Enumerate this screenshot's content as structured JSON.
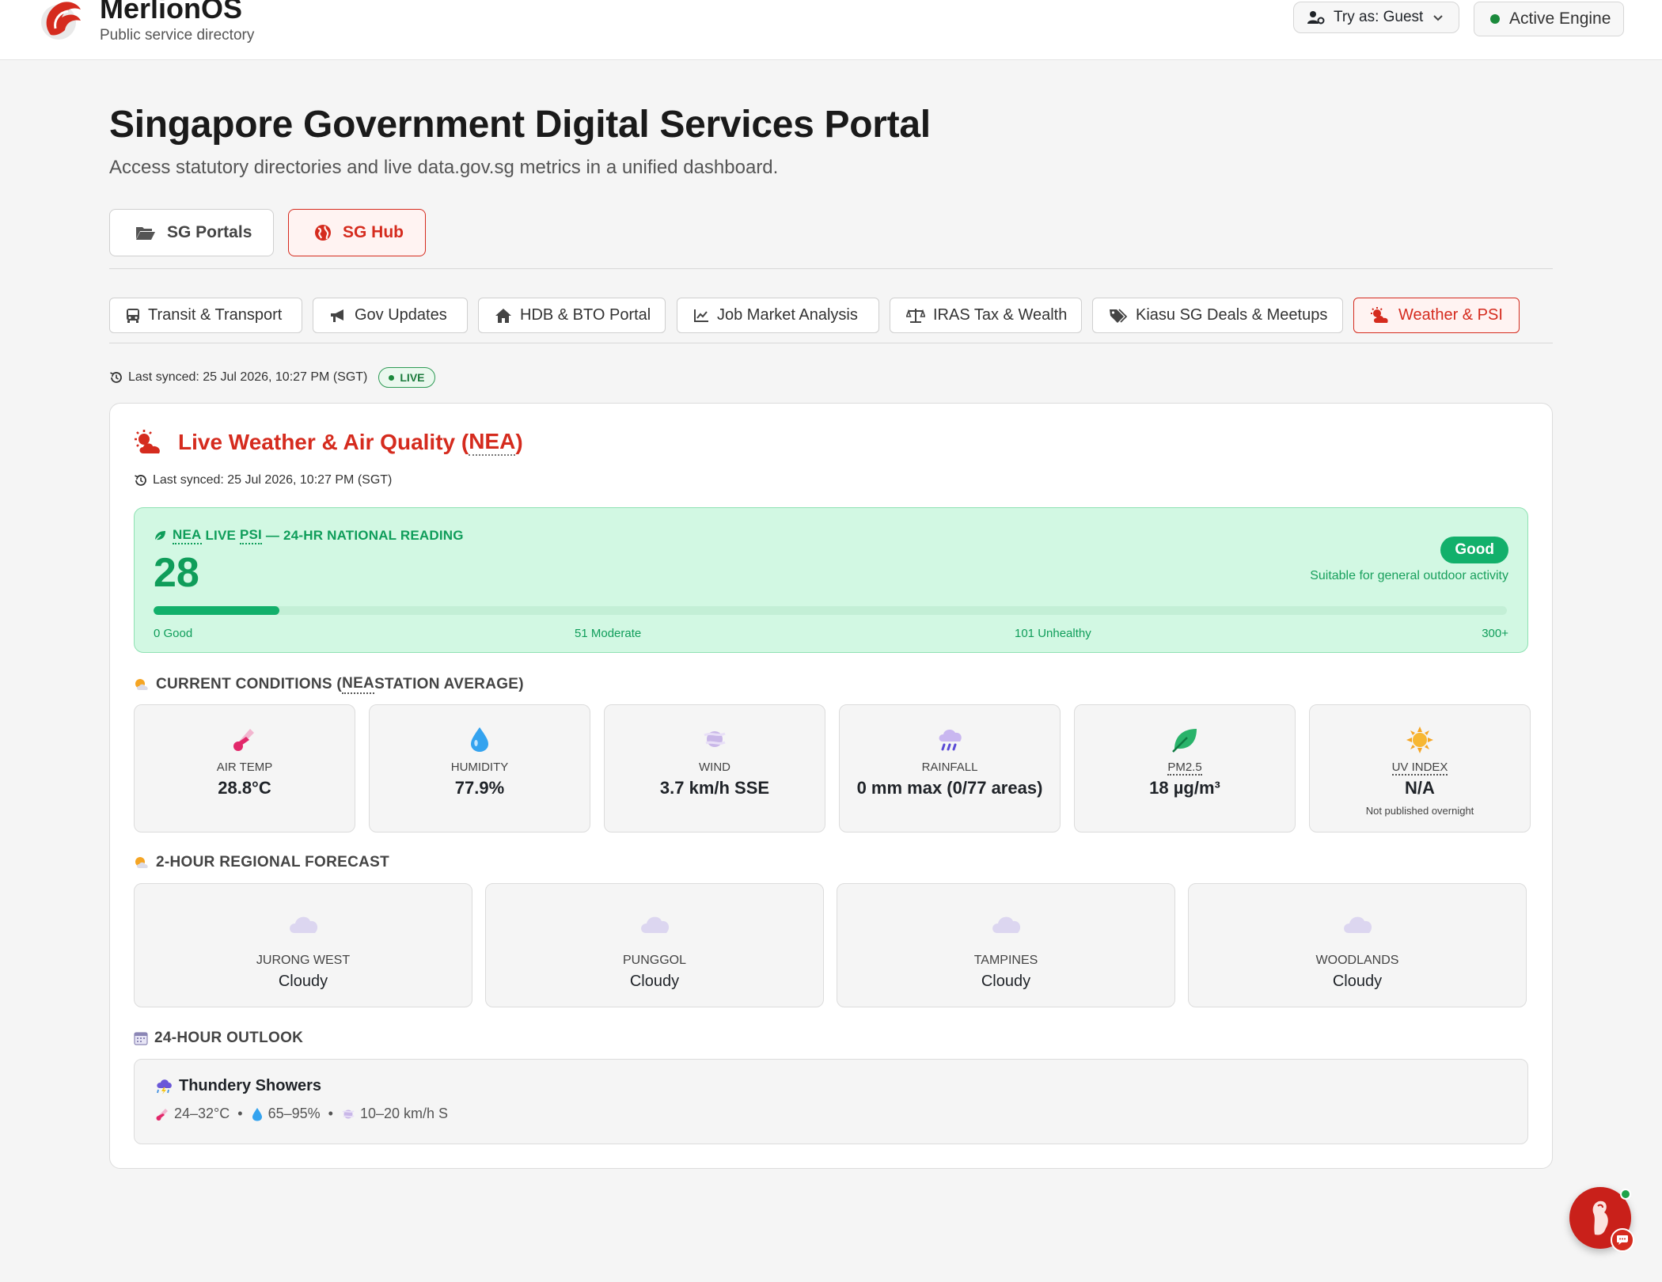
{
  "brand": {
    "name": "MerlionOS",
    "subtitle": "Public service directory"
  },
  "header": {
    "try_as_label": "Try as: Guest",
    "engine_label": "Active Engine"
  },
  "hero": {
    "title": "Singapore Government Digital Services Portal",
    "subtitle": "Access statutory directories and live data.gov.sg metrics in a unified dashboard."
  },
  "main_tabs": [
    {
      "label": "SG Portals",
      "icon": "folder-open-icon",
      "active": false
    },
    {
      "label": "SG Hub",
      "icon": "globe-icon",
      "active": true
    }
  ],
  "sub_tabs": [
    {
      "label": "Transit & Transport",
      "icon": "bus-icon",
      "active": false
    },
    {
      "label": "Gov Updates",
      "icon": "megaphone-icon",
      "active": false
    },
    {
      "label": "HDB & BTO Portal",
      "icon": "house-icon",
      "active": false
    },
    {
      "label": "Job Market Analysis",
      "icon": "chart-line-icon",
      "active": false
    },
    {
      "label": "IRAS Tax & Wealth",
      "icon": "scale-icon",
      "active": false
    },
    {
      "label": "Kiasu SG Deals & Meetups",
      "icon": "tags-icon",
      "active": false
    },
    {
      "label": "Weather & PSI",
      "icon": "cloud-sun-icon",
      "active": true
    }
  ],
  "sync": {
    "text": "Last synced: 25 Jul 2026, 10:27 PM (SGT)",
    "live_label": "LIVE"
  },
  "weather": {
    "title_prefix": "Live Weather & Air Quality (",
    "title_abbr": "NEA",
    "title_suffix": ")",
    "sync_text": "Last synced: 25 Jul 2026, 10:27 PM (SGT)",
    "psi": {
      "label_abbr1": "NEA",
      "label_mid": "LIVE",
      "label_abbr2": "PSI",
      "label_rest": "— 24-HR NATIONAL READING",
      "value": "28",
      "fill_fraction": 0.093,
      "status": "Good",
      "note": "Suitable for general outdoor activity",
      "scale": [
        "0 Good",
        "51 Moderate",
        "101 Unhealthy",
        "300+"
      ],
      "colors": {
        "good": "#12b06b",
        "card": "#d2f8e3"
      }
    },
    "conditions": {
      "label_prefix": "CURRENT CONDITIONS (",
      "label_abbr": "NEA",
      "label_suffix": " STATION AVERAGE)",
      "items": [
        {
          "label": "AIR TEMP",
          "value": "28.8°C",
          "icon": "thermometer-icon",
          "note": ""
        },
        {
          "label": "HUMIDITY",
          "value": "77.9%",
          "icon": "droplet-icon",
          "note": ""
        },
        {
          "label": "WIND",
          "value": "3.7 km/h SSE",
          "icon": "wind-icon",
          "note": ""
        },
        {
          "label": "RAINFALL",
          "value": "0 mm max (0/77 areas)",
          "icon": "rain-cloud-icon",
          "note": ""
        },
        {
          "label": "PM2.5",
          "value": "18 µg/m³",
          "icon": "leaf-icon",
          "note": ""
        },
        {
          "label": "UV INDEX",
          "value": "N/A",
          "icon": "sun-icon",
          "note": "Not published overnight"
        }
      ]
    },
    "forecast": {
      "label": "2-HOUR REGIONAL FORECAST",
      "items": [
        {
          "area": "JURONG WEST",
          "condition": "Cloudy"
        },
        {
          "area": "PUNGGOL",
          "condition": "Cloudy"
        },
        {
          "area": "TAMPINES",
          "condition": "Cloudy"
        },
        {
          "area": "WOODLANDS",
          "condition": "Cloudy"
        }
      ]
    },
    "outlook": {
      "label": "24-HOUR OUTLOOK",
      "summary": "Thundery Showers",
      "temp": "24–32°C",
      "humidity": "65–95%",
      "wind": "10–20 km/h S"
    }
  }
}
